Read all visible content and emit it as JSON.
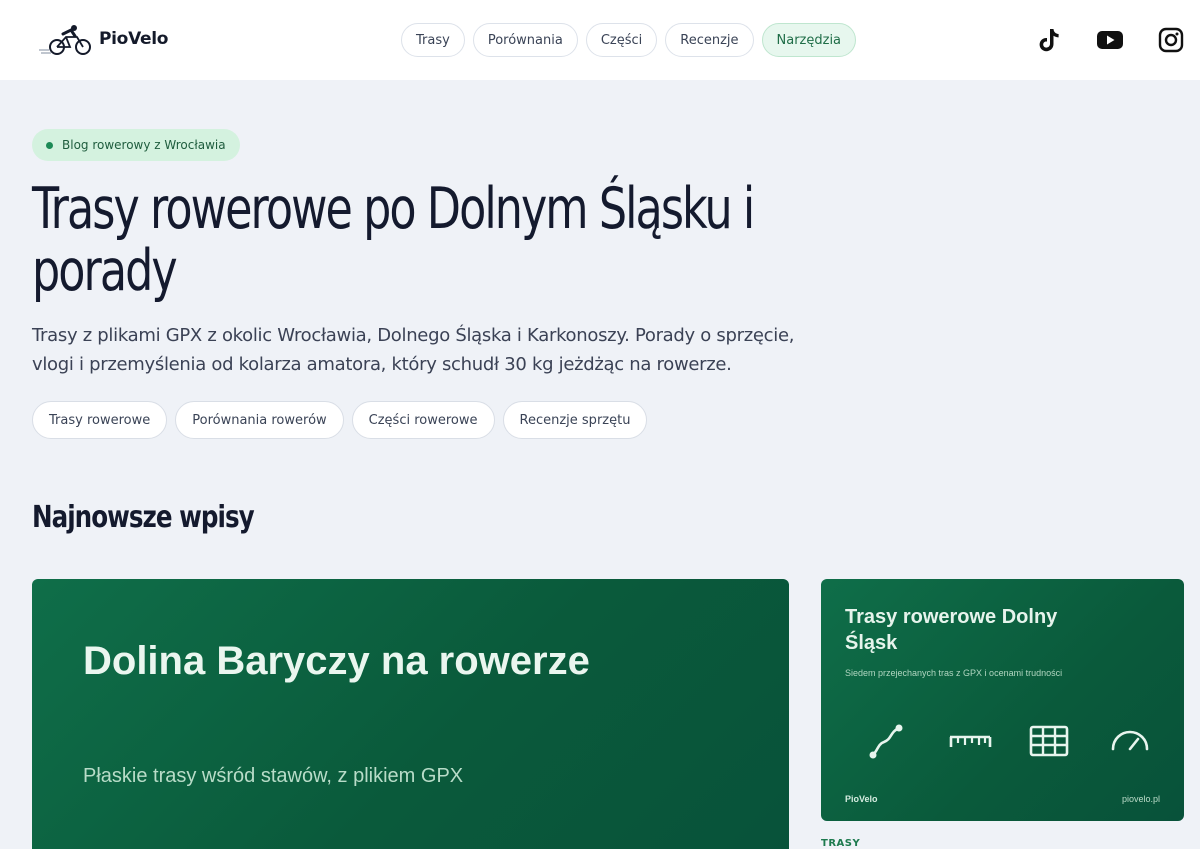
{
  "brand": {
    "name": "PioVelo",
    "accent": "#0f6e49",
    "accent_light": "#d4f2df"
  },
  "nav": {
    "items": [
      {
        "label": "Trasy",
        "active": false
      },
      {
        "label": "Porównania",
        "active": false
      },
      {
        "label": "Części",
        "active": false
      },
      {
        "label": "Recenzje",
        "active": false
      },
      {
        "label": "Narzędzia",
        "active": true
      }
    ]
  },
  "social": [
    "tiktok-icon",
    "youtube-icon",
    "instagram-icon"
  ],
  "hero": {
    "badge": "Blog rowerowy z Wrocławia",
    "title": "Trasy rowerowe po Dolnym Śląsku i porady",
    "description": "Trasy z plikami GPX z okolic Wrocławia, Dolnego Śląska i Karkonoszy. Porady o sprzęcie, vlogi i przemyślenia od kolarza amatora, który schudł 30 kg jeżdżąc na rowerze.",
    "tags": [
      "Trasy rowerowe",
      "Porównania rowerów",
      "Części rowerowe",
      "Recenzje sprzętu"
    ]
  },
  "latest": {
    "heading": "Najnowsze wpisy",
    "featured": {
      "title": "Dolina Baryczy na rowerze",
      "subtitle": "Płaskie trasy wśród stawów, z plikiem GPX"
    },
    "side": {
      "title": "Trasy rowerowe Dolny Śląsk",
      "subtitle": "Siedem przejechanych tras z GPX i ocenami trudności",
      "icons": [
        "route-icon",
        "ruler-icon",
        "grid-icon",
        "speedometer-icon"
      ],
      "footer_left": "PioVelo",
      "footer_right": "piovelo.pl",
      "category": "TRASY"
    }
  }
}
